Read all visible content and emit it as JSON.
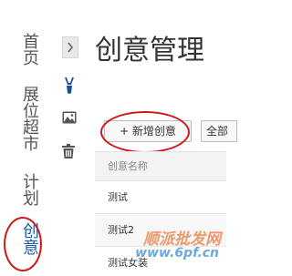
{
  "nav": {
    "items": [
      {
        "label": "首页"
      },
      {
        "label": "展位超市"
      },
      {
        "label": "计划"
      },
      {
        "label": "创意"
      }
    ]
  },
  "icons": [
    "chevron-right-icon",
    "brush-icon",
    "image-icon",
    "trash-icon"
  ],
  "page": {
    "title": "创意管理"
  },
  "toolbar": {
    "add_label": "+ 新增创意",
    "all_label": "全部"
  },
  "table": {
    "header": "创意名称",
    "rows": [
      {
        "name": "测试"
      },
      {
        "name": "测试2"
      },
      {
        "name": "测试女装"
      }
    ]
  },
  "watermark": {
    "line1": "顺派批发网",
    "line2": "www.6pf.cn"
  },
  "colors": {
    "accent": "#1a5fa8",
    "annotation": "#cc1a1a"
  }
}
